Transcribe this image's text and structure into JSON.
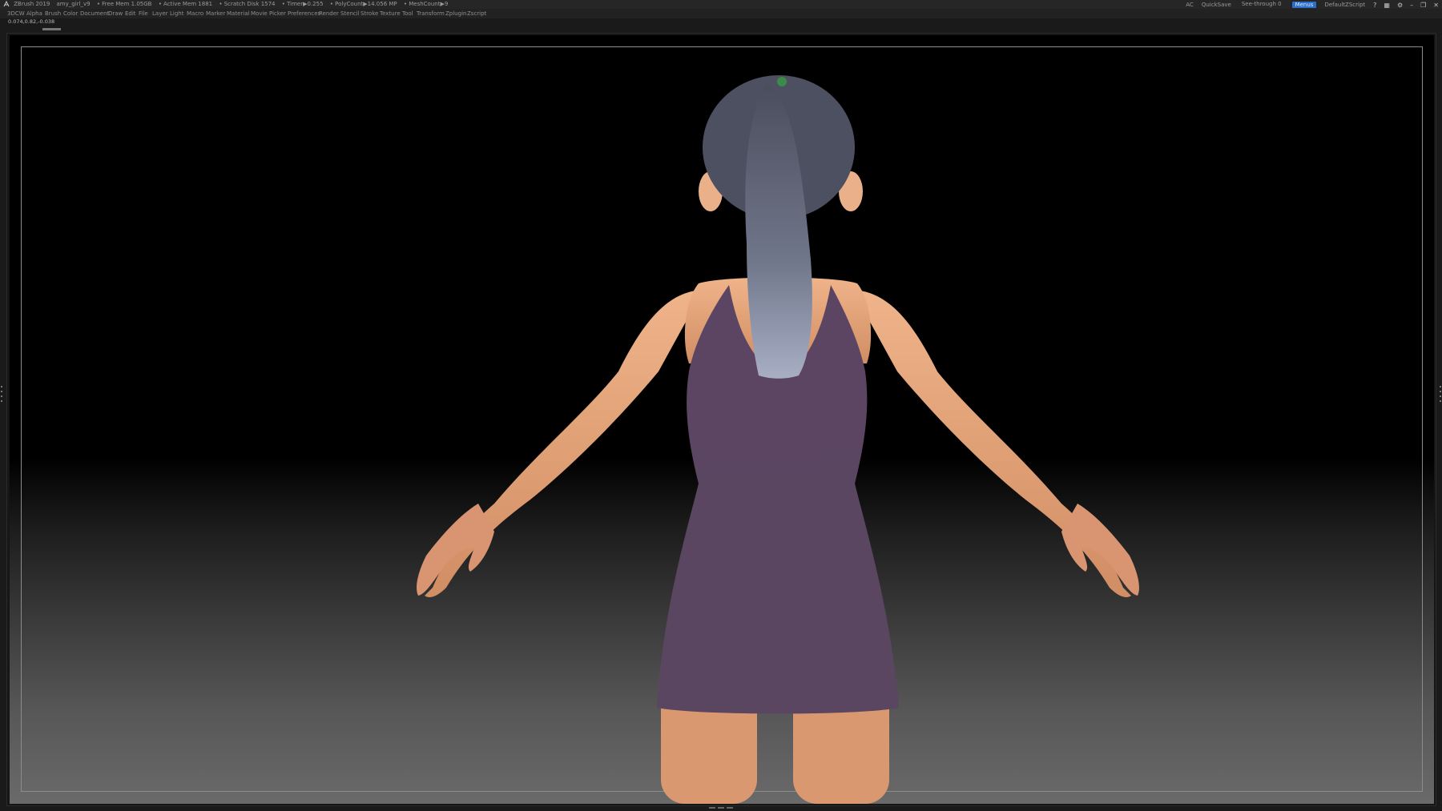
{
  "titlebar": {
    "app_name": "ZBrush 2019",
    "document": "amy_girl_v9",
    "free_mem": "• Free Mem 1.05GB",
    "active_mem": "• Active Mem 1881",
    "scratch_disk": "• Scratch Disk 1574",
    "timer": "• Timer▶0.255",
    "poly_count": "• PolyCount▶14.056 MP",
    "mesh_count": "• MeshCount▶9",
    "ac": "AC",
    "quicksave": "QuickSave",
    "see_through": "See-through  0",
    "menus_button": "Menus",
    "default_zscript": "DefaultZScript"
  },
  "menubar": {
    "items": [
      "3DCW",
      "Alpha",
      "Brush",
      "Color",
      "Document",
      "Draw",
      "Edit",
      "File",
      "Layer",
      "Light",
      "Macro",
      "Marker",
      "Material",
      "Movie",
      "Picker",
      "Preferences",
      "Render",
      "Stencil",
      "Stroke",
      "Texture",
      "Tool",
      "Transform",
      "Zplugin",
      "Zscript"
    ]
  },
  "coords": "0.074,0.82,-0.038",
  "colors": {
    "skin": "#e2a279",
    "dress": "#5f4a63",
    "hair": "#6f7384",
    "menus_accent": "#2a6fc9"
  },
  "icons": {
    "app": "zbrush-icon",
    "window": [
      "help-icon",
      "layout-icon",
      "settings-icon",
      "minimize-icon",
      "restore-icon",
      "close-icon"
    ]
  }
}
